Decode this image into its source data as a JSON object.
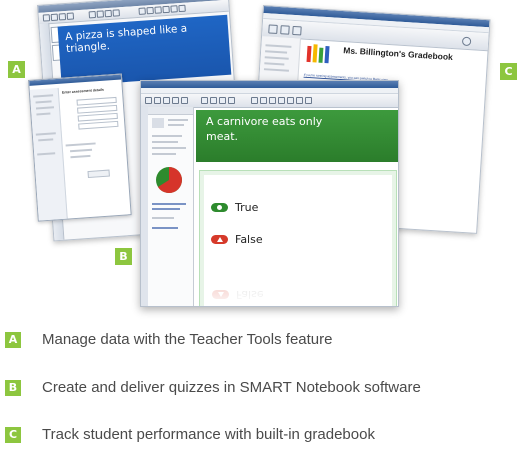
{
  "badges": {
    "a": "A",
    "b": "B",
    "c": "C"
  },
  "screenshot_a": {
    "slide_text": "A pizza is shaped like a triangle.",
    "dialog_title": "Enter assessment details"
  },
  "screenshot_b": {
    "question": "A carnivore eats only meat.",
    "answers": [
      "True",
      "False"
    ],
    "reflected_answer": "False"
  },
  "screenshot_c": {
    "gradebook_title": "Ms. Billington's Gradebook",
    "link_text": "If you're running assessments, you can switch to Basic view."
  },
  "legend": [
    {
      "badge": "A",
      "text": "Manage data with the Teacher Tools feature"
    },
    {
      "badge": "B",
      "text": "Create and deliver quizzes in SMART Notebook software"
    },
    {
      "badge": "C",
      "text": "Track student performance with built-in gradebook"
    }
  ],
  "colors": {
    "badge": "#8dc63f",
    "slide_blue": "#1f66c5",
    "quiz_green": "#2f852f",
    "true_pill": "#2e8b2e",
    "false_pill": "#d63a2a"
  }
}
